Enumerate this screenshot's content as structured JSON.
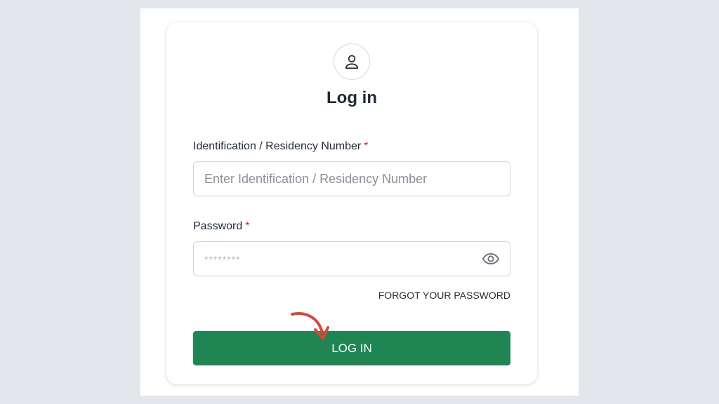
{
  "login": {
    "title": "Log in",
    "id_label": "Identification / Residency Number",
    "id_placeholder": "Enter Identification / Residency Number",
    "password_label": "Password",
    "password_placeholder": "********",
    "required_mark": "*",
    "forgot_password": "FORGOT YOUR PASSWORD",
    "submit_label": "LOG IN"
  },
  "icons": {
    "avatar": "user-icon",
    "password_toggle": "eye-icon",
    "annotation": "curved-arrow-icon"
  },
  "colors": {
    "background": "#e3e7eb",
    "card": "#ffffff",
    "primary_button": "#1f8553",
    "required": "#d32f2f",
    "arrow": "#d9463a"
  }
}
